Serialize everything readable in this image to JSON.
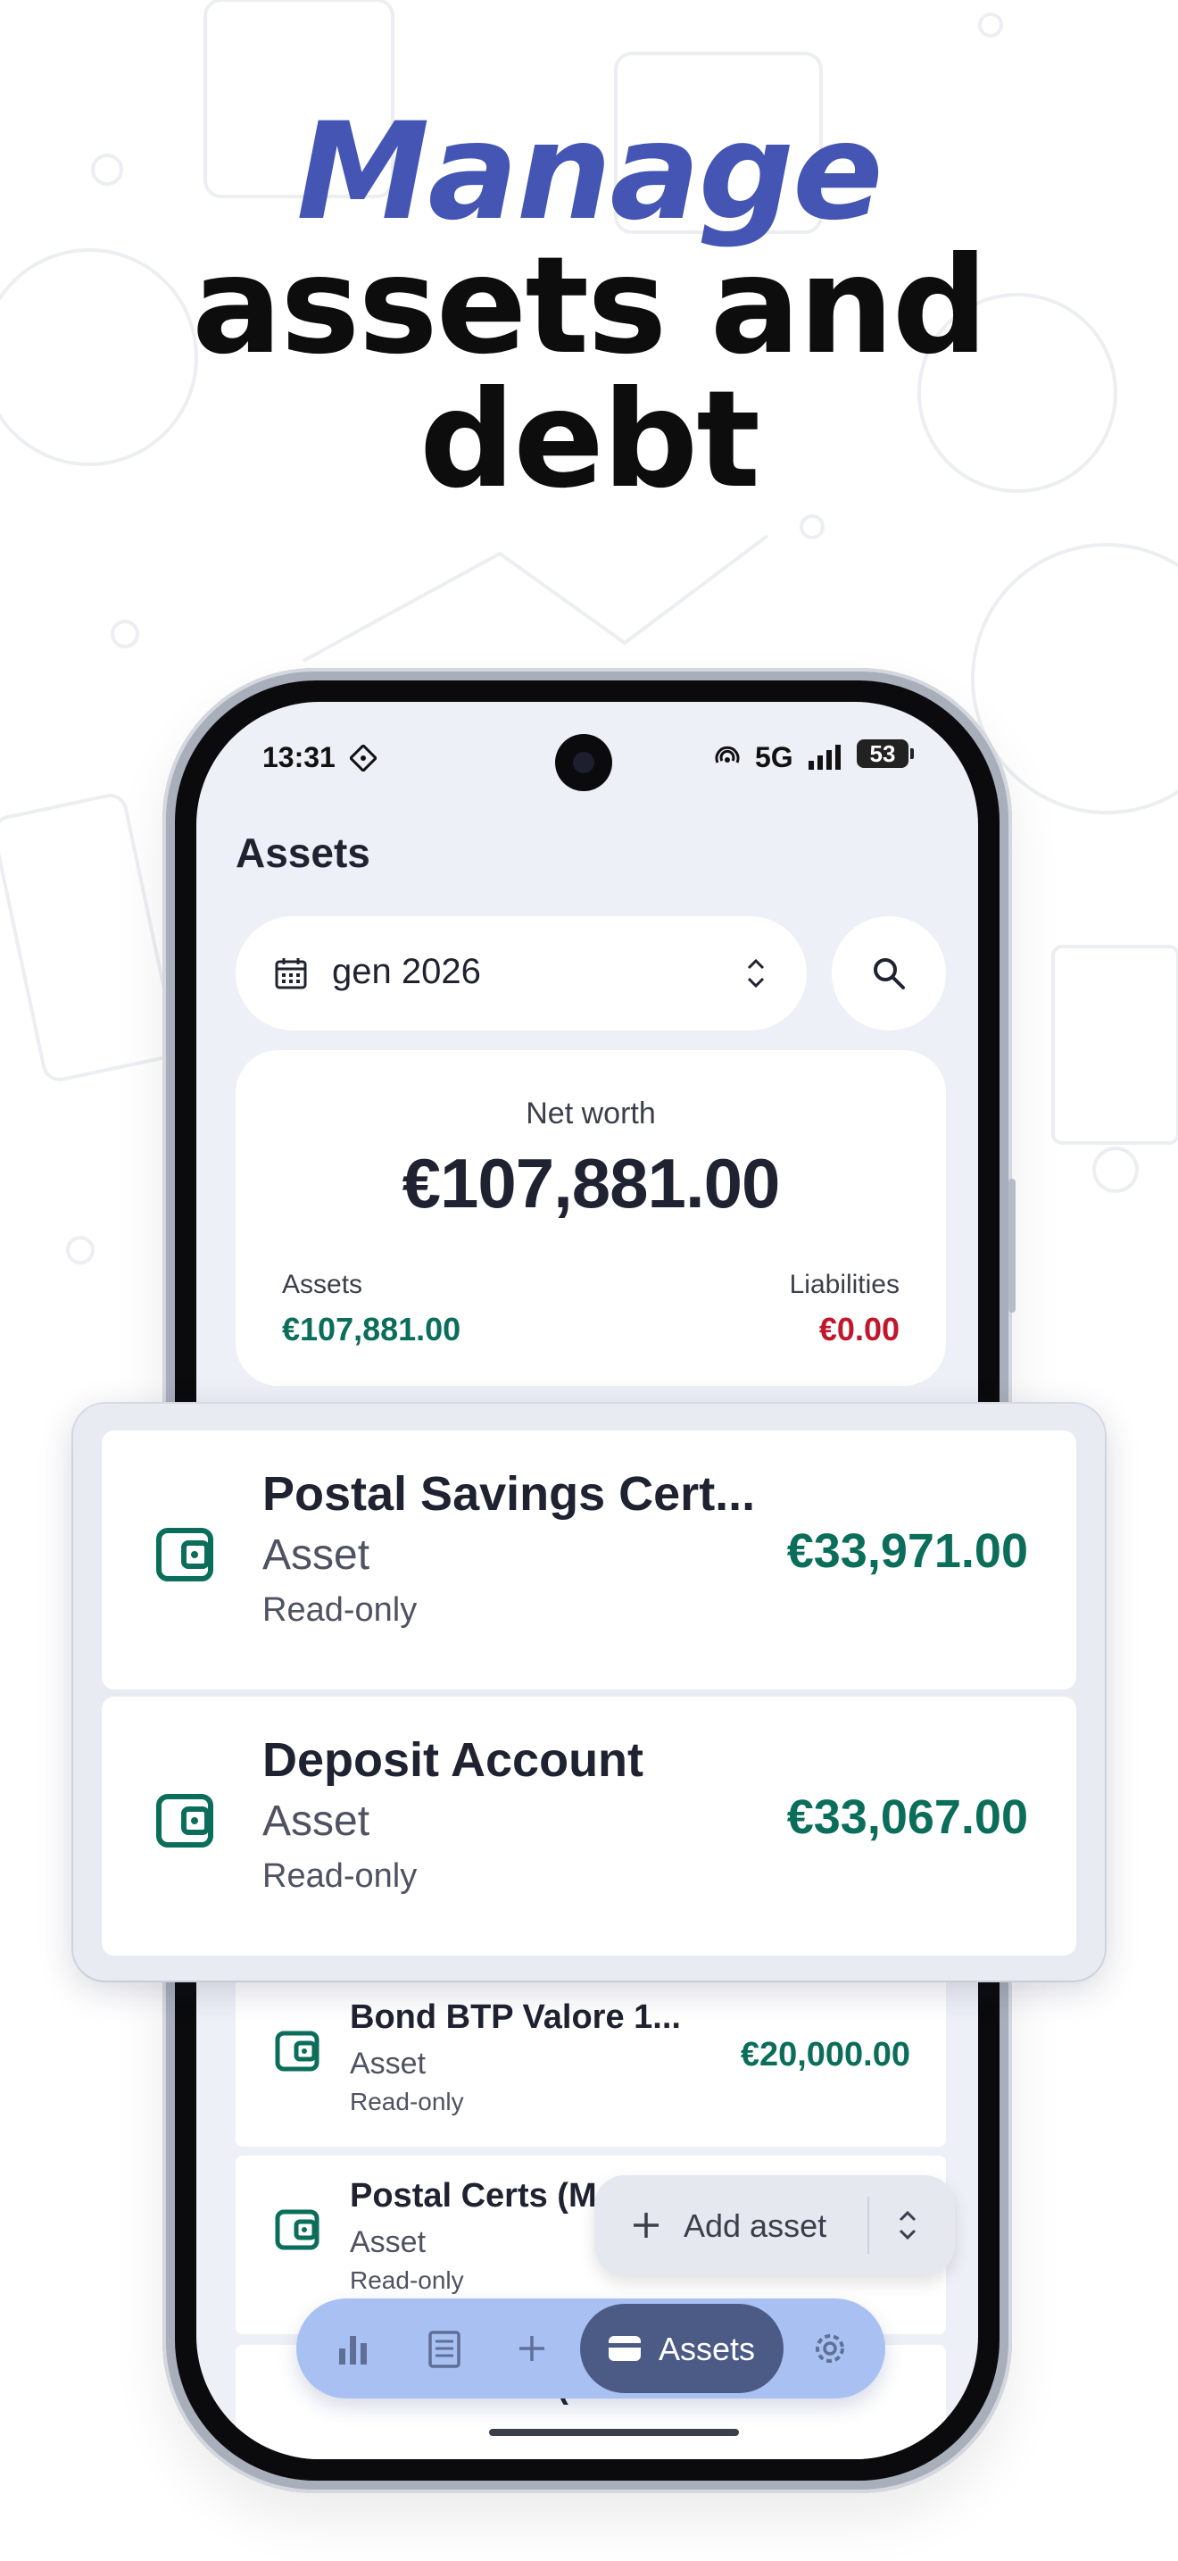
{
  "headline": {
    "accent": "Manage",
    "line2": "assets and",
    "line3": "debt"
  },
  "status_bar": {
    "time": "13:31",
    "network": "5G",
    "battery": "53"
  },
  "app": {
    "title": "Assets",
    "month_selector": {
      "value": "gen 2026"
    },
    "net_worth": {
      "label": "Net worth",
      "value": "€107,881.00",
      "assets_label": "Assets",
      "assets_value": "€107,881.00",
      "liabilities_label": "Liabilities",
      "liabilities_value": "€0.00"
    },
    "list": [
      {
        "name": "Bond BTP Valore 1...",
        "type": "Asset",
        "status": "Read-only",
        "amount": "€20,000.00"
      },
      {
        "name": "Postal Certs (M",
        "type": "Asset",
        "status": "Read-only",
        "amount": ""
      },
      {
        "name": "Postal Certs (Minor",
        "type": "",
        "status": "",
        "amount": ""
      }
    ],
    "fab": {
      "label": "Add asset"
    },
    "bottom_nav": {
      "active_label": "Assets"
    }
  },
  "overlay": [
    {
      "name": "Postal Savings Cert...",
      "type": "Asset",
      "status": "Read-only",
      "amount": "€33,971.00"
    },
    {
      "name": "Deposit Account",
      "type": "Asset",
      "status": "Read-only",
      "amount": "€33,067.00"
    }
  ],
  "colors": {
    "accent_headline": "#4455b3",
    "positive_amount": "#0b6e5a",
    "negative_amount": "#c0182a",
    "nav_bar": "#a9c1f2",
    "nav_active": "#4b5b86"
  },
  "icons": [
    "calendar-icon",
    "chevron-up-down-icon",
    "search-icon",
    "wallet-icon",
    "plus-icon",
    "bar-chart-icon",
    "list-icon",
    "gear-icon",
    "cast-icon",
    "signal-icon",
    "hotspot-icon"
  ]
}
